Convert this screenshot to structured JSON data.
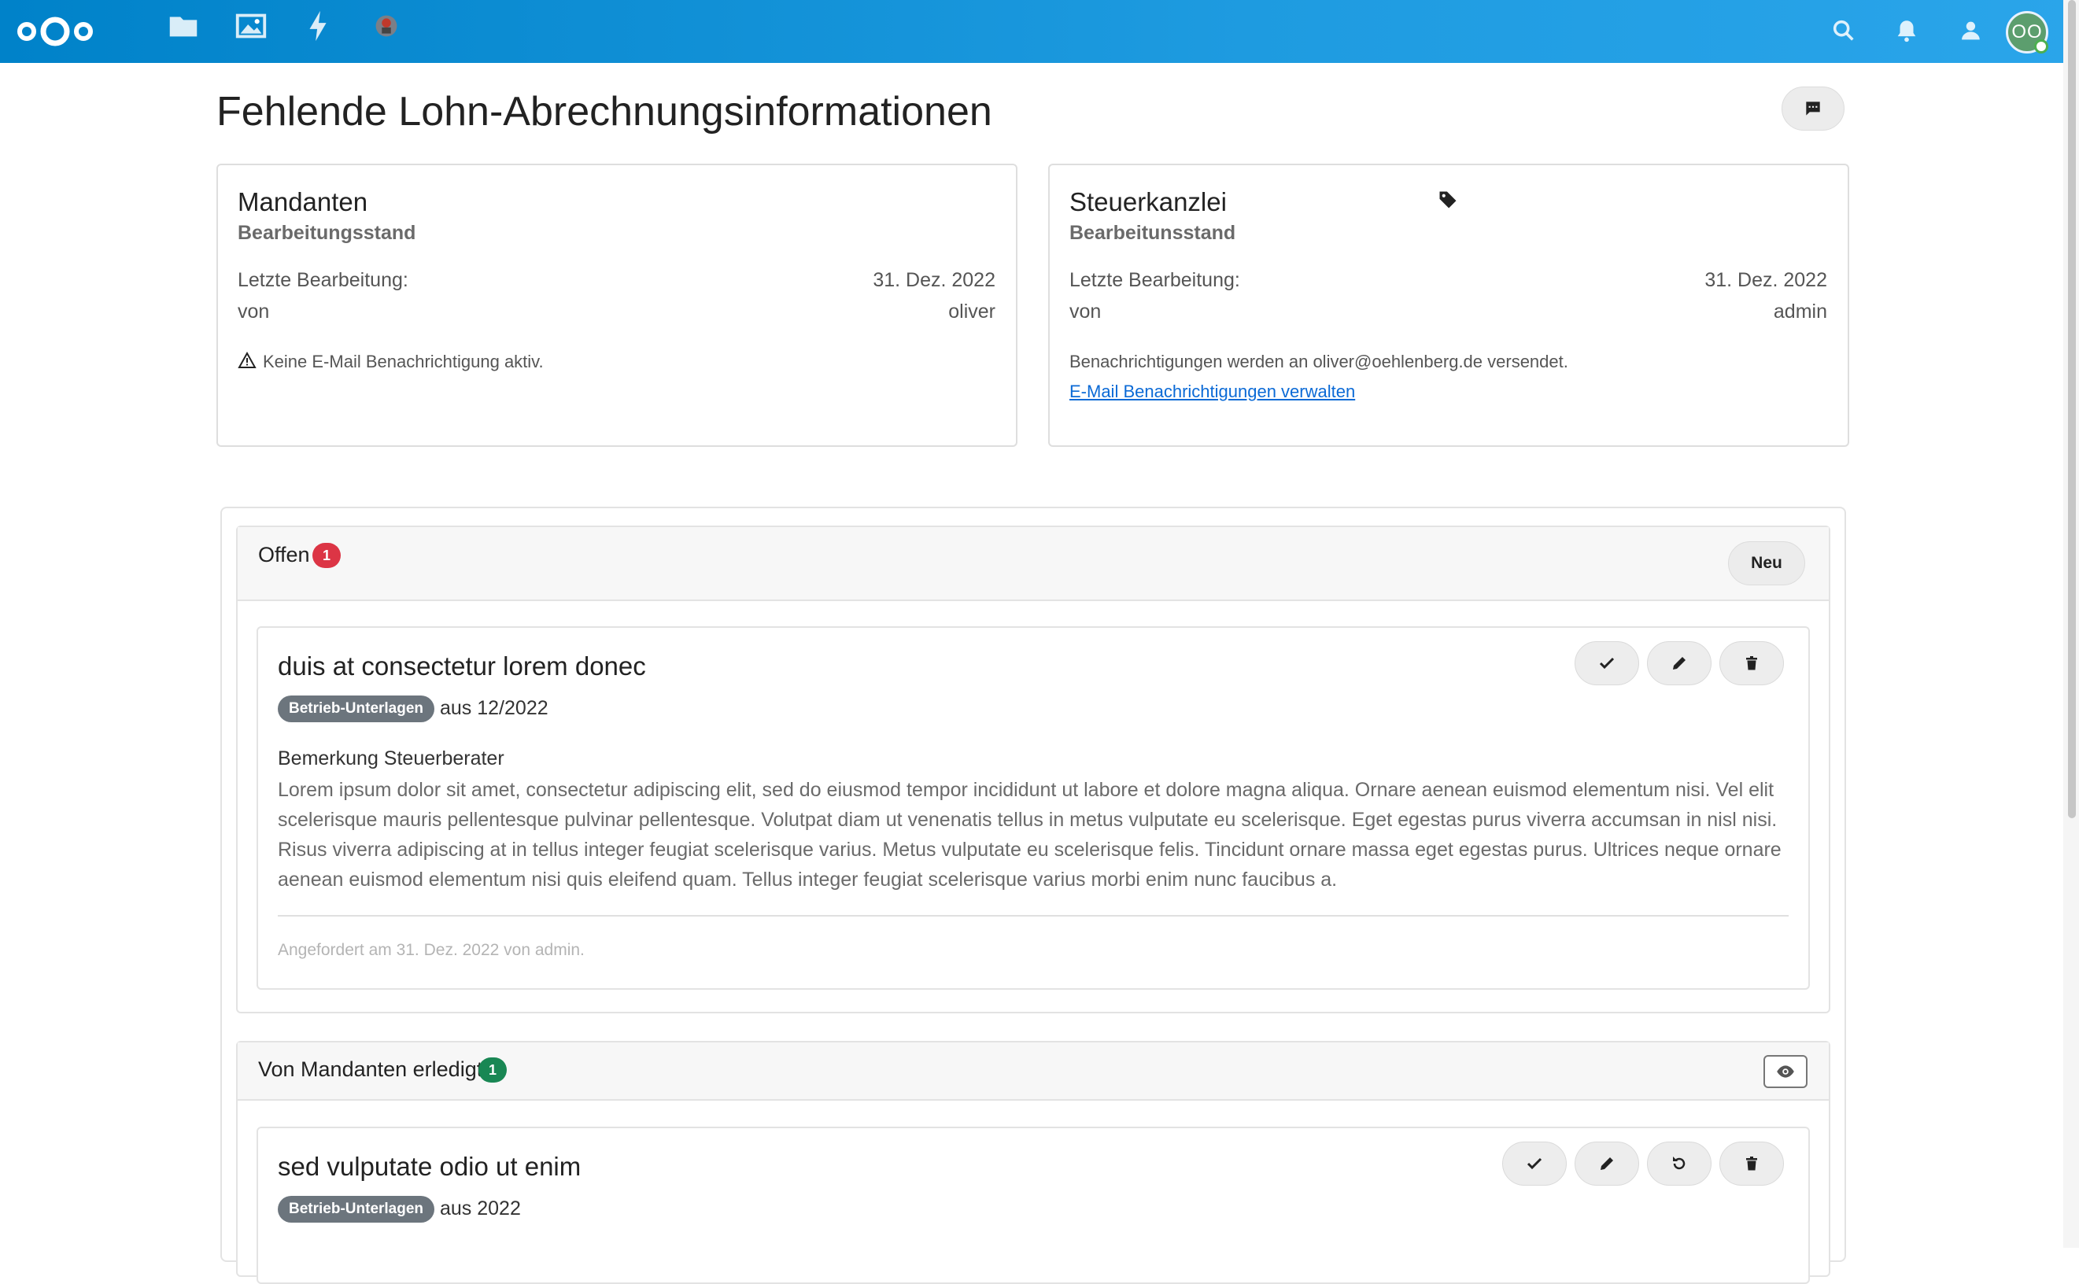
{
  "app": {
    "logo": "nextcloud-logo"
  },
  "nav": {
    "icons": [
      "files-icon",
      "photos-icon",
      "activity-icon",
      "app-avatar-icon"
    ]
  },
  "header_right": {
    "icons": [
      "search-icon",
      "bell-icon",
      "contacts-icon"
    ],
    "avatar_initials": "OO"
  },
  "page": {
    "title": "Fehlende Lohn-Abrechnungsinformationen"
  },
  "mandanten": {
    "title": "Mandanten",
    "subtitle": "Bearbeitungsstand",
    "last_edit_label": "Letzte Bearbeitung:",
    "last_edit_value": "31. Dez. 2022",
    "by_label": "von",
    "by_value": "oliver",
    "warning": "Keine E-Mail Benachrichtigung aktiv."
  },
  "kanzlei": {
    "title": "Steuerkanzlei",
    "subtitle": "Bearbeitunsstand",
    "last_edit_label": "Letzte Bearbeitung:",
    "last_edit_value": "31. Dez. 2022",
    "by_label": "von",
    "by_value": "admin",
    "notice": "Benachrichtigungen werden an oliver@oehlenberg.de versendet.",
    "link": "E-Mail Benachrichtigungen verwalten"
  },
  "offen": {
    "title": "Offen",
    "count": "1",
    "badge_color": "#dc3545",
    "new_button": "Neu",
    "item": {
      "title": "duis at consectetur lorem donec",
      "tag": "Betrieb-Unterlagen",
      "period": "aus 12/2022",
      "remark_label": "Bemerkung Steuerberater",
      "remark": "Lorem ipsum dolor sit amet, consectetur adipiscing elit, sed do eiusmod tempor incididunt ut labore et dolore magna aliqua. Ornare aenean euismod elementum nisi. Vel elit scelerisque mauris pellentesque pulvinar pellentesque. Volutpat diam ut venenatis tellus in metus vulputate eu scelerisque. Eget egestas purus viverra accumsan in nisl nisi. Risus viverra adipiscing at in tellus integer feugiat scelerisque varius. Metus vulputate eu scelerisque felis. Tincidunt ornare massa eget egestas purus. Ultrices neque ornare aenean euismod elementum nisi quis eleifend quam. Tellus integer feugiat scelerisque varius morbi enim nunc faucibus a.",
      "meta": "Angefordert am 31. Dez. 2022 von admin."
    }
  },
  "erledigt": {
    "title": "Von Mandanten erledigt",
    "count": "1",
    "badge_color": "#198754",
    "item": {
      "title": "sed vulputate odio ut enim",
      "tag": "Betrieb-Unterlagen",
      "period": "aus 2022"
    }
  },
  "colors": {
    "topbar": "#0082c9",
    "link": "#0b6ad6"
  }
}
